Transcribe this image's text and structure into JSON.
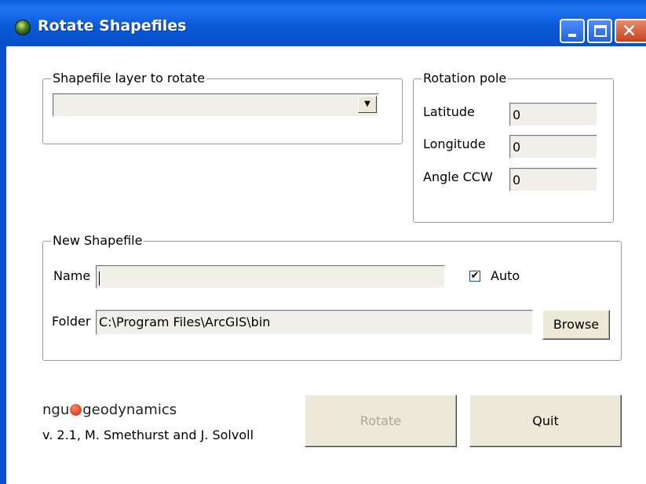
{
  "window": {
    "title": "Rotate Shapefiles",
    "close_glyph": "✕"
  },
  "layer_group": {
    "legend": "Shapefile layer to rotate",
    "selected_value": "",
    "arrow_glyph": "▼"
  },
  "pole_group": {
    "legend": "Rotation pole",
    "latitude_label": "Latitude",
    "latitude_value": "0",
    "longitude_label": "Longitude",
    "longitude_value": "0",
    "angle_label": "Angle CCW",
    "angle_value": "0"
  },
  "new_shapefile_group": {
    "legend": "New Shapefile",
    "name_label": "Name",
    "name_value": "",
    "auto_label": "Auto",
    "auto_checked": true,
    "check_glyph": "✔",
    "folder_label": "Folder",
    "folder_value": "C:\\Program Files\\ArcGIS\\bin",
    "browse_label": "Browse"
  },
  "footer": {
    "logo_left": "ngu",
    "logo_right": "geodynamics",
    "version_text": "v. 2.1, M. Smethurst and J. Solvoll",
    "rotate_label": "Rotate",
    "rotate_enabled": false,
    "quit_label": "Quit"
  },
  "icons": [
    "app-globe-icon",
    "minimize-icon",
    "maximize-icon",
    "close-icon",
    "dropdown-arrow-icon",
    "checkmark-icon"
  ],
  "colors": {
    "titlebar": "#0a5fe0",
    "close_button": "#c8401c",
    "button_face": "#ece9d8",
    "textbox": "#f0efe8"
  }
}
